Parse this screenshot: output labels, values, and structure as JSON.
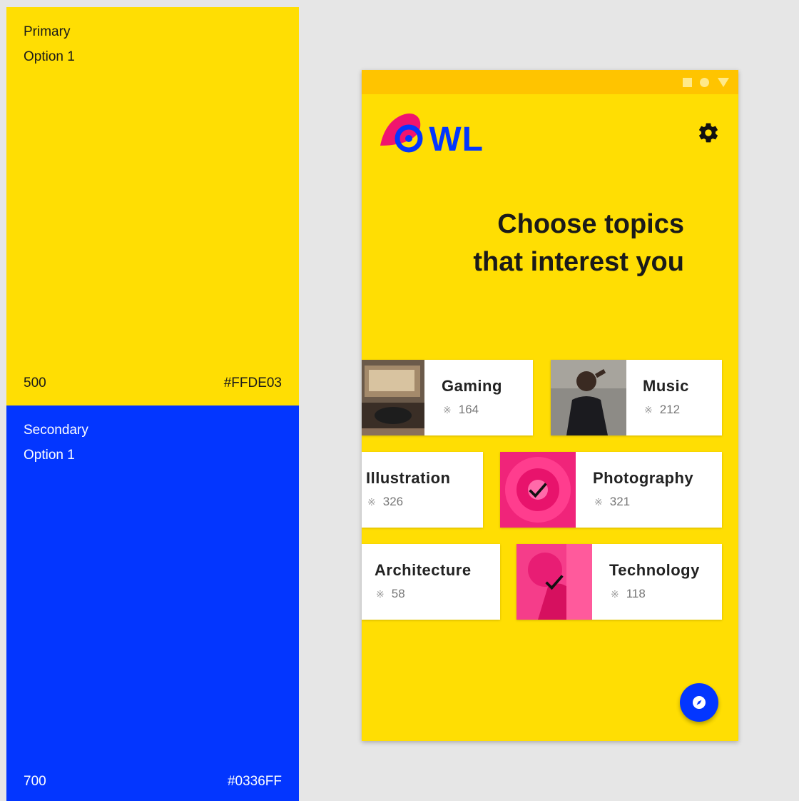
{
  "palette": {
    "primary": {
      "label": "Primary",
      "option": "Option 1",
      "shade": "500",
      "hex": "#FFDE03"
    },
    "secondary": {
      "label": "Secondary",
      "option": "Option 1",
      "shade": "700",
      "hex": "#0336FF"
    }
  },
  "app": {
    "logo_text": "OWL",
    "headline_line1": "Choose topics",
    "headline_line2": "that interest you",
    "topics": [
      {
        "name": "Gaming",
        "count": "164",
        "selected": false
      },
      {
        "name": "Music",
        "count": "212",
        "selected": false
      },
      {
        "name": "Illustration",
        "count": "326",
        "selected": false
      },
      {
        "name": "Photography",
        "count": "321",
        "selected": true
      },
      {
        "name": "Architecture",
        "count": "58",
        "selected": false
      },
      {
        "name": "Technology",
        "count": "118",
        "selected": true
      }
    ],
    "icons": {
      "settings": "gear-icon",
      "fab": "compass-icon",
      "count": "grid-dots-icon",
      "selected": "check-icon"
    },
    "colors": {
      "background": "#FFDE03",
      "status_bar": "#FFC400",
      "accent": "#0336FF",
      "logo_pink": "#F0146E"
    }
  }
}
